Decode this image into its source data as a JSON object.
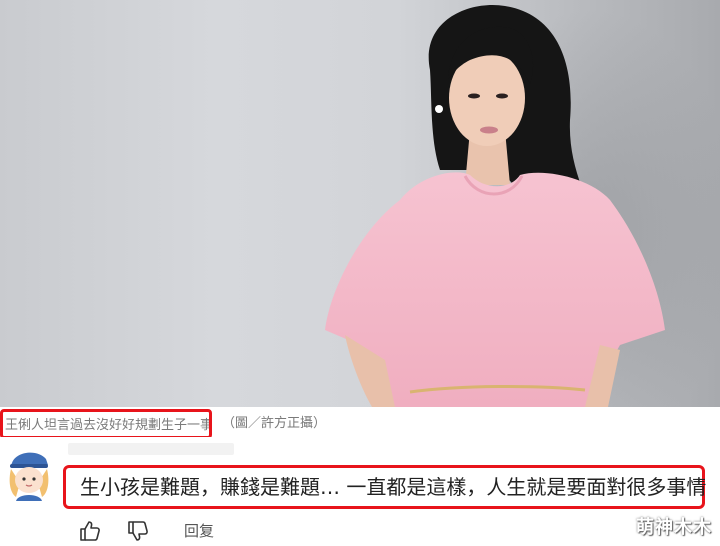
{
  "caption": {
    "main_text": "王俐人坦言過去沒好好規劃生子一事",
    "credit_text": "（圖／許方正攝）"
  },
  "comment": {
    "text": "生小孩是難題，賺錢是難題… 一直都是這樣，人生就是要面對很多事情",
    "reply_label": "回复",
    "like_icon": "thumbs-up-icon",
    "dislike_icon": "thumbs-down-icon"
  },
  "watermark": {
    "text": "萌神木木"
  },
  "colors": {
    "highlight_border": "#e8141b",
    "dress": "#f3b8c8",
    "background_wall": "#d2d4d8"
  }
}
